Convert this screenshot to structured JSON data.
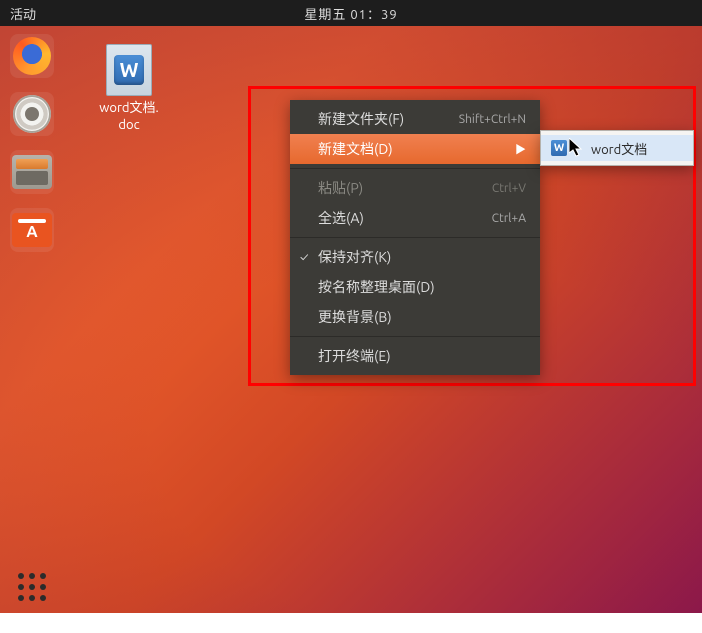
{
  "topbar": {
    "activities": "活动",
    "clock": "星期五 01：39"
  },
  "launcher": {
    "apps": [
      {
        "name": "firefox"
      },
      {
        "name": "rhythmbox"
      },
      {
        "name": "files"
      },
      {
        "name": "software"
      }
    ],
    "show_apps": "show-applications"
  },
  "desktop": {
    "icon": {
      "letter": "W",
      "label_line1": "word文档.",
      "label_line2": "doc"
    }
  },
  "context_menu": {
    "items": [
      {
        "id": "new-folder",
        "label": "新建文件夹(F)",
        "shortcut": "Shift+Ctrl+N",
        "disabled": false,
        "has_submenu": false
      },
      {
        "id": "new-document",
        "label": "新建文档(D)",
        "shortcut": "",
        "disabled": false,
        "has_submenu": true,
        "hover": true
      },
      {
        "sep": true
      },
      {
        "id": "paste",
        "label": "粘贴(P)",
        "shortcut": "Ctrl+V",
        "disabled": true
      },
      {
        "id": "select-all",
        "label": "全选(A)",
        "shortcut": "Ctrl+A",
        "disabled": false
      },
      {
        "sep": true
      },
      {
        "id": "keep-aligned",
        "label": "保持对齐(K)",
        "checked": true
      },
      {
        "id": "organize",
        "label": "按名称整理桌面(D)"
      },
      {
        "id": "change-bg",
        "label": "更换背景(B)"
      },
      {
        "sep": true
      },
      {
        "id": "open-terminal",
        "label": "打开终端(E)"
      }
    ]
  },
  "submenu": {
    "items": [
      {
        "id": "word-doc",
        "icon_letter": "W",
        "label": "word文档",
        "hover": true
      }
    ]
  }
}
